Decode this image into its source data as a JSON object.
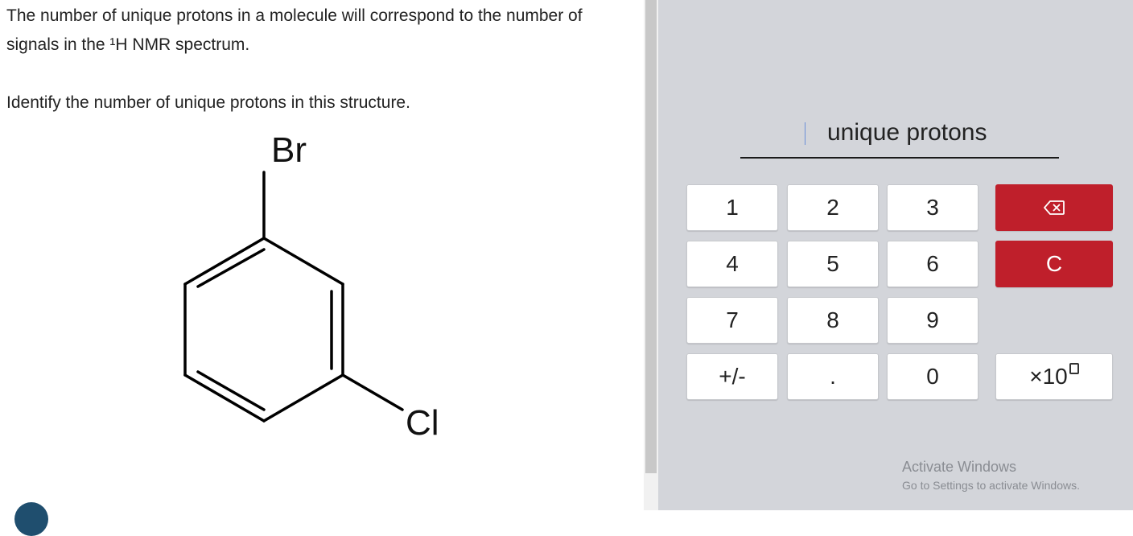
{
  "question": {
    "line1": "The number of unique protons in a molecule will correspond to the number of signals in the ¹H NMR spectrum.",
    "line2": "Identify the number of unique protons in this structure."
  },
  "molecule": {
    "atom_top": "Br",
    "atom_bottom": "Cl"
  },
  "answer": {
    "unit": "unique protons"
  },
  "keypad": {
    "k1": "1",
    "k2": "2",
    "k3": "3",
    "k4": "4",
    "k5": "5",
    "k6": "6",
    "k7": "7",
    "k8": "8",
    "k9": "9",
    "k_sign": "+/-",
    "k_dot": ".",
    "k0": "0",
    "k_clear": "C",
    "k_sci": "×10"
  },
  "watermark": {
    "title": "Activate Windows",
    "subtitle": "Go to Settings to activate Windows."
  },
  "colors": {
    "accent_red": "#bf1f2b",
    "panel_bg": "#d3d5da"
  }
}
